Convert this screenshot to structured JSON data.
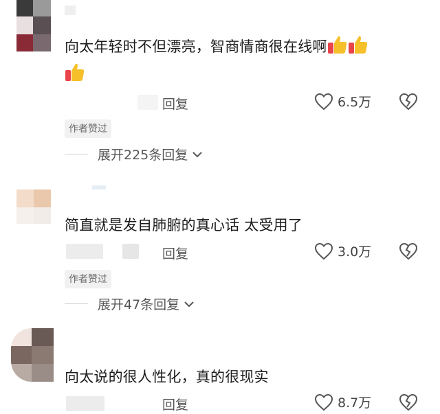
{
  "comments": [
    {
      "text": "向太年轻时不但漂亮，智商情商很在线啊",
      "emojis": [
        "thumbs-up-icon",
        "thumbs-up-icon",
        "thumbs-up-icon"
      ],
      "date_fragment": "",
      "reply_label": "回复",
      "like_count": "6.5万",
      "author_badge": "作者赞过",
      "expand_label": "展开225条回复"
    },
    {
      "text": "简直就是发自肺腑的真心话 太受用了",
      "emojis": [],
      "date_fragment": "",
      "reply_label": "回复",
      "like_count": "3.0万",
      "author_badge": "作者赞过",
      "expand_label": "展开47条回复"
    },
    {
      "text": "向太说的很人性化，真的很现实",
      "emojis": [],
      "date_fragment": "",
      "reply_label": "回复",
      "like_count": "8.7万",
      "author_badge": "",
      "expand_label": ""
    }
  ],
  "colors": {
    "text": "#1c1c1c",
    "secondary": "#555555",
    "badge_bg": "#f1f1f1",
    "icon_stroke": "#555555",
    "thumb_yellow": "#f6c02a",
    "thumb_red": "#e8444a"
  }
}
